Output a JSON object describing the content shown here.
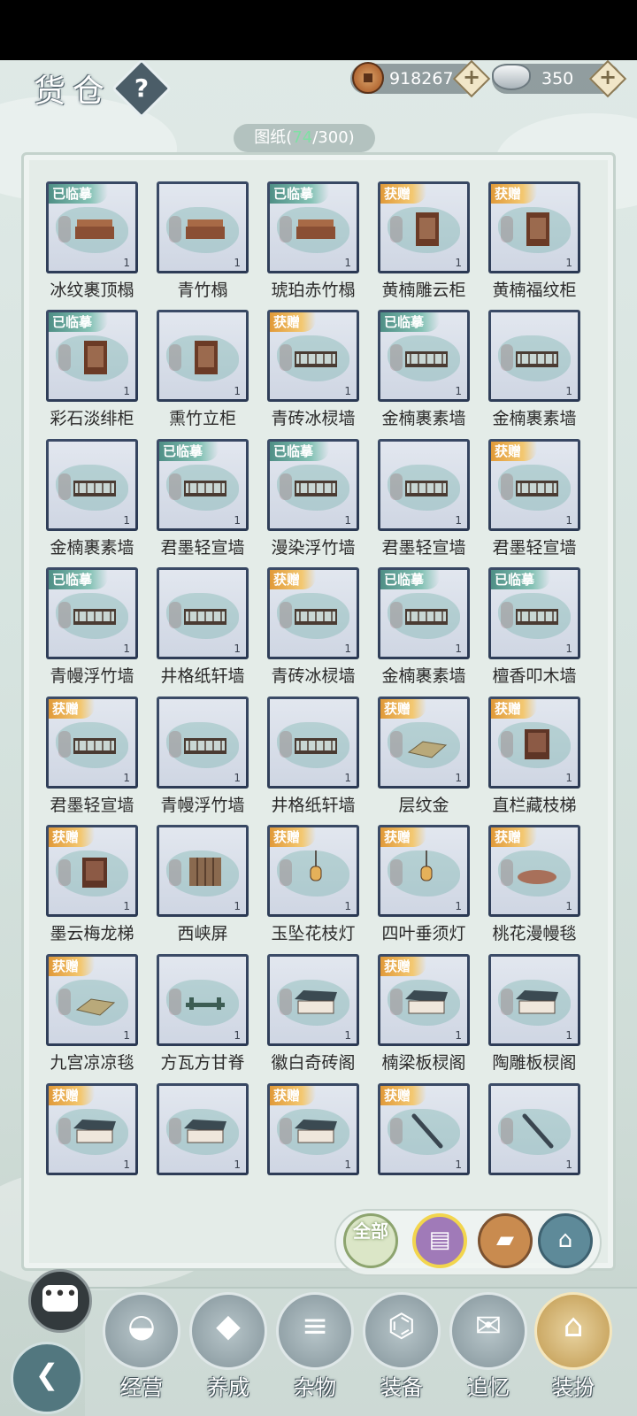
{
  "header": {
    "title": "货仓",
    "help_label": "?",
    "coins": "918267",
    "ingots": "350",
    "plus": "+"
  },
  "panel": {
    "count_label": "图纸",
    "count_open": "(",
    "count_have": "74",
    "count_sep": "/300)"
  },
  "items": [
    {
      "name": "冰纹裹顶榻",
      "badge": "已临摹",
      "badge_type": "copy",
      "qty": "1"
    },
    {
      "name": "青竹榻",
      "badge": "",
      "badge_type": "",
      "qty": "1"
    },
    {
      "name": "琥珀赤竹榻",
      "badge": "已临摹",
      "badge_type": "copy",
      "qty": "1"
    },
    {
      "name": "黄楠雕云柜",
      "badge": "获赠",
      "badge_type": "gift",
      "qty": "1"
    },
    {
      "name": "黄楠福纹柜",
      "badge": "获赠",
      "badge_type": "gift",
      "qty": "1"
    },
    {
      "name": "彩石淡绯柜",
      "badge": "已临摹",
      "badge_type": "copy",
      "qty": "1"
    },
    {
      "name": "熏竹立柜",
      "badge": "",
      "badge_type": "",
      "qty": "1"
    },
    {
      "name": "青砖冰棂墙",
      "badge": "获赠",
      "badge_type": "gift",
      "qty": "1"
    },
    {
      "name": "金楠裹素墙",
      "badge": "已临摹",
      "badge_type": "copy",
      "qty": "1"
    },
    {
      "name": "金楠裹素墙",
      "badge": "",
      "badge_type": "",
      "qty": "1"
    },
    {
      "name": "金楠裹素墙",
      "badge": "",
      "badge_type": "",
      "qty": "1"
    },
    {
      "name": "君墨轻宣墙",
      "badge": "已临摹",
      "badge_type": "copy",
      "qty": "1"
    },
    {
      "name": "漫染浮竹墙",
      "badge": "已临摹",
      "badge_type": "copy",
      "qty": "1"
    },
    {
      "name": "君墨轻宣墙",
      "badge": "",
      "badge_type": "",
      "qty": "1"
    },
    {
      "name": "君墨轻宣墙",
      "badge": "获赠",
      "badge_type": "gift",
      "qty": "1"
    },
    {
      "name": "青幔浮竹墙",
      "badge": "已临摹",
      "badge_type": "copy",
      "qty": "1"
    },
    {
      "name": "井格纸轩墙",
      "badge": "",
      "badge_type": "",
      "qty": "1"
    },
    {
      "name": "青砖冰棂墙",
      "badge": "获赠",
      "badge_type": "gift",
      "qty": "1"
    },
    {
      "name": "金楠裹素墙",
      "badge": "已临摹",
      "badge_type": "copy",
      "qty": "1"
    },
    {
      "name": "檀香叩木墙",
      "badge": "已临摹",
      "badge_type": "copy",
      "qty": "1"
    },
    {
      "name": "君墨轻宣墙",
      "badge": "获赠",
      "badge_type": "gift",
      "qty": "1"
    },
    {
      "name": "青幔浮竹墙",
      "badge": "",
      "badge_type": "",
      "qty": "1"
    },
    {
      "name": "井格纸轩墙",
      "badge": "",
      "badge_type": "",
      "qty": "1"
    },
    {
      "name": "层纹金",
      "badge": "获赠",
      "badge_type": "gift",
      "qty": "1"
    },
    {
      "name": "直栏藏枝梯",
      "badge": "获赠",
      "badge_type": "gift",
      "qty": "1"
    },
    {
      "name": "墨云梅龙梯",
      "badge": "获赠",
      "badge_type": "gift",
      "qty": "1"
    },
    {
      "name": "西峡屏",
      "badge": "",
      "badge_type": "",
      "qty": "1"
    },
    {
      "name": "玉坠花枝灯",
      "badge": "获赠",
      "badge_type": "gift",
      "qty": "1"
    },
    {
      "name": "四叶垂须灯",
      "badge": "获赠",
      "badge_type": "gift",
      "qty": "1"
    },
    {
      "name": "桃花漫幔毯",
      "badge": "获赠",
      "badge_type": "gift",
      "qty": "1"
    },
    {
      "name": "九宫凉凉毯",
      "badge": "获赠",
      "badge_type": "gift",
      "qty": "1"
    },
    {
      "name": "方瓦方甘脊",
      "badge": "",
      "badge_type": "",
      "qty": "1"
    },
    {
      "name": "徽白奇砖阁",
      "badge": "",
      "badge_type": "",
      "qty": "1"
    },
    {
      "name": "楠梁板棂阁",
      "badge": "获赠",
      "badge_type": "gift",
      "qty": "1"
    },
    {
      "name": "陶雕板棂阁",
      "badge": "",
      "badge_type": "",
      "qty": "1"
    },
    {
      "name": "",
      "badge": "获赠",
      "badge_type": "gift",
      "qty": "1"
    },
    {
      "name": "",
      "badge": "",
      "badge_type": "",
      "qty": "1"
    },
    {
      "name": "",
      "badge": "获赠",
      "badge_type": "gift",
      "qty": "1"
    },
    {
      "name": "",
      "badge": "获赠",
      "badge_type": "gift",
      "qty": "1"
    },
    {
      "name": "",
      "badge": "",
      "badge_type": "",
      "qty": "1"
    }
  ],
  "filters": {
    "all_label": "全部",
    "icons": [
      "scroll-icon",
      "wood-block-icon",
      "tree-stump-icon"
    ]
  },
  "nav": [
    {
      "label": "经营",
      "icon": "bowl-icon"
    },
    {
      "label": "养成",
      "icon": "pearl-icon"
    },
    {
      "label": "杂物",
      "icon": "bundle-icon"
    },
    {
      "label": "装备",
      "icon": "robe-icon"
    },
    {
      "label": "追忆",
      "icon": "letter-icon"
    },
    {
      "label": "装扮",
      "icon": "pavilion-icon"
    }
  ],
  "colors": {
    "gift_badge": "#e9a94a",
    "copy_badge": "#6aa99d",
    "count_highlight": "#7fe0a4"
  }
}
